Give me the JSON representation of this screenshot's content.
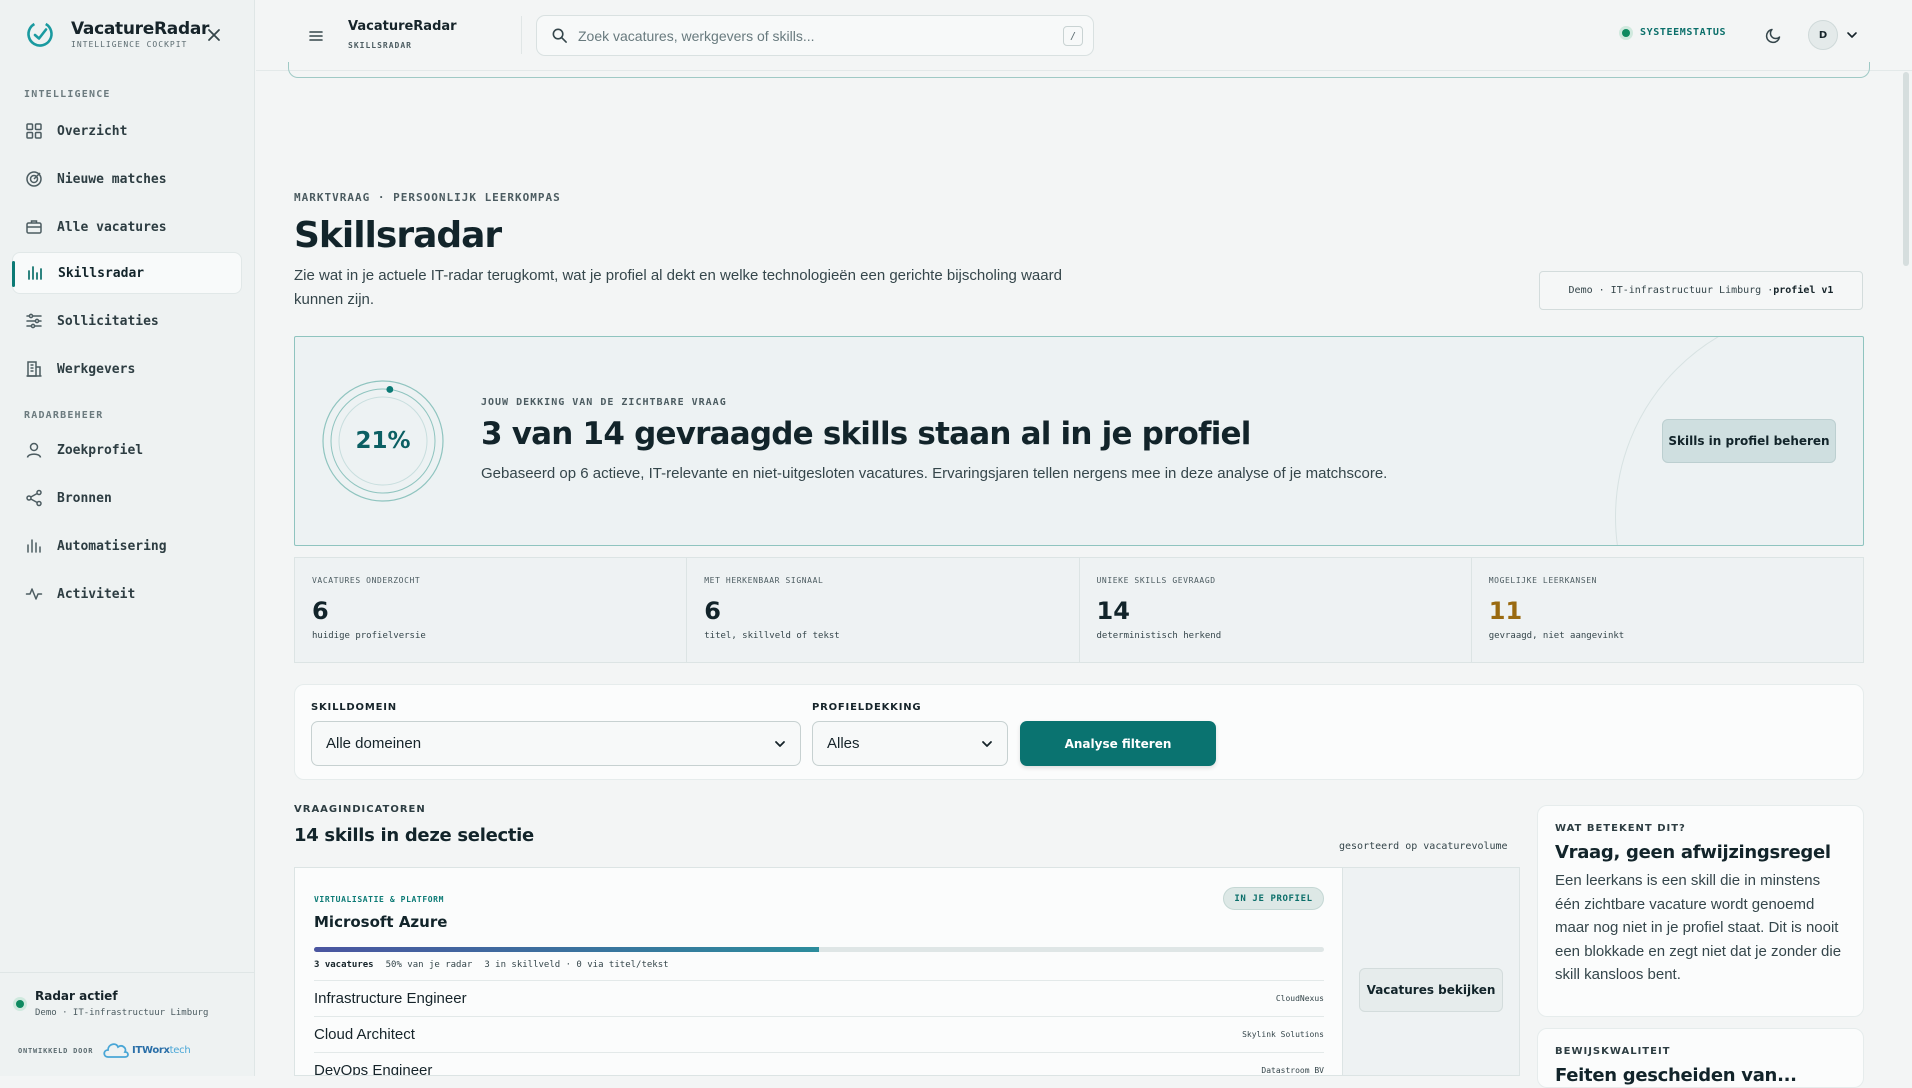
{
  "brand": {
    "name": "VacatureRadar",
    "subtitle": "INTELLIGENCE COCKPIT"
  },
  "sidebar": {
    "sections": [
      {
        "title": "INTELLIGENCE"
      },
      {
        "title": "RADARBEHEER"
      }
    ],
    "items": [
      {
        "label": "Overzicht",
        "icon": "grid-icon"
      },
      {
        "label": "Nieuwe matches",
        "icon": "target-icon"
      },
      {
        "label": "Alle vacatures",
        "icon": "briefcase-icon"
      },
      {
        "label": "Skillsradar",
        "icon": "bar-chart-icon",
        "active": true
      },
      {
        "label": "Sollicitaties",
        "icon": "sliders-icon"
      },
      {
        "label": "Werkgevers",
        "icon": "building-icon"
      },
      {
        "label": "Zoekprofiel",
        "icon": "user-icon"
      },
      {
        "label": "Bronnen",
        "icon": "share-icon"
      },
      {
        "label": "Automatisering",
        "icon": "bar-chart-icon"
      },
      {
        "label": "Activiteit",
        "icon": "activity-icon"
      }
    ],
    "footer": {
      "status_title": "Radar actief",
      "status_sub": "Demo · IT-infrastructuur Limburg",
      "developed_by": "ONTWIKKELD DOOR",
      "dev_logo_a": "ITWorx",
      "dev_logo_b": "tech"
    }
  },
  "topbar": {
    "title": "VacatureRadar",
    "subtitle": "SKILLSRADAR",
    "search_placeholder": "Zoek vacatures, werkgevers of skills...",
    "search_shortcut": "/",
    "system_status": "SYSTEEMSTATUS",
    "avatar_initial": "D"
  },
  "page": {
    "eyebrow": "MARKTVRAAG · PERSOONLIJK LEERKOMPAS",
    "title": "Skillsradar",
    "lede": "Zie wat in je actuele IT-radar terugkomt, wat je profiel al dekt en welke technologieën een gerichte bijscholing waard kunnen zijn.",
    "demo_chip_a": "Demo · IT-infrastructuur Limburg · ",
    "demo_chip_b": "profiel v1"
  },
  "hero": {
    "coverage_percent": 21,
    "coverage_label": "21%",
    "eyebrow": "JOUW DEKKING VAN DE ZICHTBARE VRAAG",
    "title": "3 van 14 gevraagde skills staan al in je profiel",
    "subtitle": "Gebaseerd op 6 actieve, IT-relevante en niet-uitgesloten vacatures. Ervaringsjaren tellen nergens mee in deze analyse of je matchscore.",
    "button": "Skills in profiel beheren"
  },
  "stats": [
    {
      "label": "VACATURES ONDERZOCHT",
      "value": "6",
      "sub": "huidige profielversie"
    },
    {
      "label": "MET HERKENBAAR SIGNAAL",
      "value": "6",
      "sub": "titel, skillveld of tekst"
    },
    {
      "label": "UNIEKE SKILLS GEVRAAGD",
      "value": "14",
      "sub": "deterministisch herkend"
    },
    {
      "label": "MOGELIJKE LEERKANSEN",
      "value": "11",
      "sub": "gevraagd, niet aangevinkt"
    }
  ],
  "filters": {
    "domain_label": "SKILLDOMEIN",
    "domain_value": "Alle domeinen",
    "coverage_label": "PROFIELDEKKING",
    "coverage_value": "Alles",
    "button": "Analyse filteren"
  },
  "indicators": {
    "eyebrow": "VRAAGINDICATOREN",
    "title": "14 skills in deze selectie",
    "sorted": "gesorteerd op vacaturevolume"
  },
  "skill_card": {
    "category": "VIRTUALISATIE & PLATFORM",
    "name": "Microsoft Azure",
    "badge": "IN JE PROFIEL",
    "share": 0.5,
    "meta_vacatures": "3 vacatures",
    "meta_share": "50% van je radar",
    "meta_skillveld": "3 in skillveld · 0 via titel/tekst",
    "jobs": [
      {
        "title": "Infrastructure Engineer",
        "company": "CloudNexus"
      },
      {
        "title": "Cloud Architect",
        "company": "Skylink Solutions"
      },
      {
        "title": "DevOps Engineer",
        "company": "Datastroom BV"
      }
    ],
    "button": "Vacatures bekijken"
  },
  "info1": {
    "eyebrow": "WAT BETEKENT DIT?",
    "title": "Vraag, geen afwijzingsregel",
    "text": "Een leerkans is een skill die in minstens één zichtbare vacature wordt genoemd maar nog niet in je profiel staat. Dit is nooit een blokkade en zegt niet dat je zonder die skill kansloos bent."
  },
  "info2": {
    "eyebrow": "BEWIJSKWALITEIT",
    "title": "Feiten gescheiden van..."
  },
  "colors": {
    "accent": "#0a7370",
    "amber": "#9a6a10",
    "ok": "#0e8a60"
  }
}
